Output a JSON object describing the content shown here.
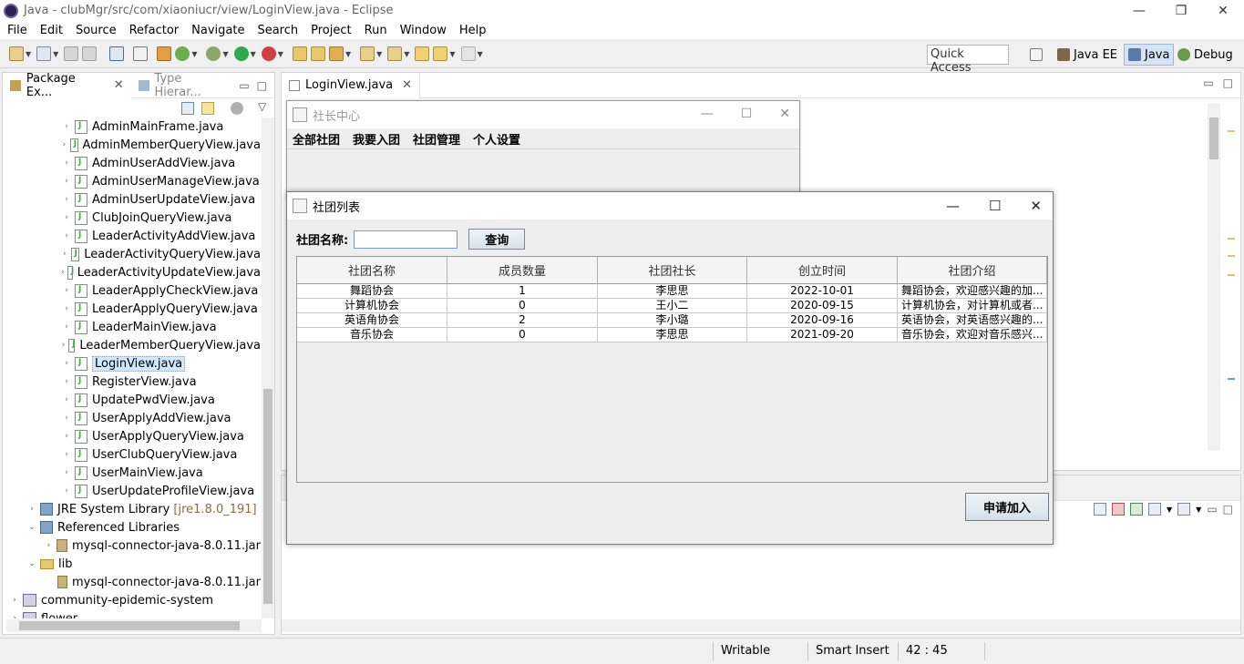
{
  "window": {
    "title": "Java - clubMgr/src/com/xiaoniucr/view/LoginView.java - Eclipse",
    "controls": [
      "—",
      "❐",
      "✕"
    ]
  },
  "menu": [
    "File",
    "Edit",
    "Source",
    "Refactor",
    "Navigate",
    "Search",
    "Project",
    "Run",
    "Window",
    "Help"
  ],
  "toolbar": {
    "quick_access": "Quick Access",
    "perspectives": [
      "Java EE",
      "Java",
      "Debug"
    ]
  },
  "package_explorer": {
    "tab_label": "Package Ex...",
    "tab2_label": "Type Hierar...",
    "files": [
      "AdminMainFrame.java",
      "AdminMemberQueryView.java",
      "AdminUserAddView.java",
      "AdminUserManageView.java",
      "AdminUserUpdateView.java",
      "ClubJoinQueryView.java",
      "LeaderActivityAddView.java",
      "LeaderActivityQueryView.java",
      "LeaderActivityUpdateView.java",
      "LeaderApplyCheckView.java",
      "LeaderApplyQueryView.java",
      "LeaderMainView.java",
      "LeaderMemberQueryView.java",
      "LoginView.java",
      "RegisterView.java",
      "UpdatePwdView.java",
      "UserApplyAddView.java",
      "UserApplyQueryView.java",
      "UserClubQueryView.java",
      "UserMainView.java",
      "UserUpdateProfileView.java"
    ],
    "jre_label": "JRE System Library",
    "jre_version": "[jre1.8.0_191]",
    "ref_libs": "Referenced Libraries",
    "ref_jar": "mysql-connector-java-8.0.11.jar",
    "lib_folder": "lib",
    "lib_jar": "mysql-connector-java-8.0.11.jar",
    "project2": "community-epidemic-system",
    "project3": "flower"
  },
  "editor": {
    "tab_label": "LoginView.java"
  },
  "status_bar": {
    "writable": "Writable",
    "insert_mode": "Smart Insert",
    "position": "42 : 45"
  },
  "back_frame": {
    "title": "社长中心",
    "menu": [
      "全部社团",
      "我要入团",
      "社团管理",
      "个人设置"
    ]
  },
  "front_frame": {
    "title": "社团列表",
    "search_label": "社团名称:",
    "search_value": "",
    "search_button": "查询",
    "columns": [
      "社团名称",
      "成员数量",
      "社团社长",
      "创立时间",
      "社团介绍"
    ],
    "rows": [
      [
        "舞蹈协会",
        "1",
        "李思思",
        "2022-10-01",
        "舞蹈协会，欢迎感兴趣的加..."
      ],
      [
        "计算机协会",
        "0",
        "王小二",
        "2020-09-15",
        "计算机协会，对计算机或者..."
      ],
      [
        "英语角协会",
        "2",
        "李小璐",
        "2020-09-16",
        "英语协会，对英语感兴趣的..."
      ],
      [
        "音乐协会",
        "0",
        "李思思",
        "2021-09-20",
        "音乐协会，欢迎对音乐感兴..."
      ]
    ],
    "apply_button": "申请加入"
  }
}
